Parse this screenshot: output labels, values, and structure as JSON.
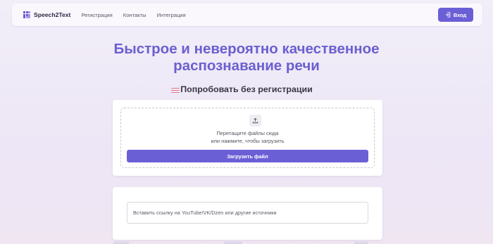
{
  "nav": {
    "logo": "Speech2Text",
    "links": [
      "Регистрация",
      "Контакты",
      "Интеграция"
    ],
    "login": "Вход"
  },
  "hero": {
    "line1": "Быстрое и невероятно качественное",
    "line2": "распознавание речи",
    "subtitle": "Попробовать без регистрации"
  },
  "upload": {
    "drop_line1": "Перетащите файлы сюда",
    "drop_line2": "или нажмите, чтобы загрузить",
    "button": "Загрузить файл"
  },
  "link": {
    "placeholder": "Вставить ссылку на YouTube/VK/Dzen или другие источники"
  },
  "colors": {
    "accent": "#6b5fd6",
    "headline": "#6b5fd0",
    "scribble": "#e87a86"
  },
  "icons": [
    "logo-grid-icon",
    "login-icon",
    "upload-icon"
  ]
}
